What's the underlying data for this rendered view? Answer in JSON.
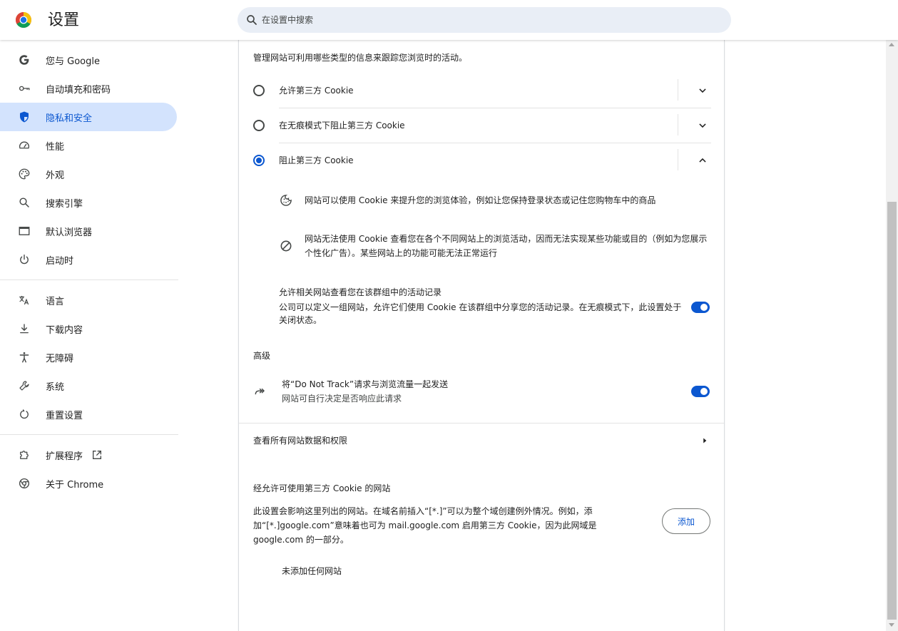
{
  "header": {
    "title": "设置",
    "search_placeholder": "在设置中搜索"
  },
  "sidebar": {
    "items": [
      {
        "label": "您与 Google",
        "icon": "google-g-icon"
      },
      {
        "label": "自动填充和密码",
        "icon": "key-icon"
      },
      {
        "label": "隐私和安全",
        "icon": "shield-icon",
        "active": true
      },
      {
        "label": "性能",
        "icon": "speedometer-icon"
      },
      {
        "label": "外观",
        "icon": "palette-icon"
      },
      {
        "label": "搜索引擎",
        "icon": "search-icon"
      },
      {
        "label": "默认浏览器",
        "icon": "browser-window-icon"
      },
      {
        "label": "启动时",
        "icon": "power-icon"
      },
      {
        "label": "语言",
        "icon": "translate-icon"
      },
      {
        "label": "下载内容",
        "icon": "download-icon"
      },
      {
        "label": "无障碍",
        "icon": "accessibility-icon"
      },
      {
        "label": "系统",
        "icon": "wrench-icon"
      },
      {
        "label": "重置设置",
        "icon": "reset-icon"
      },
      {
        "label": "扩展程序",
        "icon": "extension-puzzle-icon"
      },
      {
        "label": "关于 Chrome",
        "icon": "chrome-icon"
      }
    ]
  },
  "main": {
    "intro": "管理网站可利用哪些类型的信息来跟踪您浏览时的活动。",
    "options": [
      {
        "label": "允许第三方 Cookie",
        "selected": false,
        "expanded": false
      },
      {
        "label": "在无痕模式下阻止第三方 Cookie",
        "selected": false,
        "expanded": false
      },
      {
        "label": "阻止第三方 Cookie",
        "selected": true,
        "expanded": true
      }
    ],
    "details": [
      {
        "icon": "cookie-icon",
        "text": "网站可以使用 Cookie 来提升您的浏览体验，例如让您保持登录状态或记住您购物车中的商品"
      },
      {
        "icon": "block-icon",
        "text": "网站无法使用 Cookie 查看您在各个不同网站上的浏览活动，因而无法实现某些功能或目的（例如为您展示个性化广告）。某些网站上的功能可能无法正常运行"
      }
    ],
    "related_sites": {
      "title": "允许相关网站查看您在该群组中的活动记录",
      "subtitle": "公司可以定义一组网站，允许它们使用 Cookie 在该群组中分享您的活动记录。在无痕模式下，此设置处于关闭状态。",
      "enabled": true
    },
    "advanced_heading": "高级",
    "dnt": {
      "title": "将“Do Not Track”请求与浏览流量一起发送",
      "subtitle": "网站可自行决定是否响应此请求",
      "enabled": true
    },
    "site_data_link": "查看所有网站数据和权限",
    "allowed_sites": {
      "heading": "经允许可使用第三方 Cookie 的网站",
      "description": "此设置会影响这里列出的网站。在域名前插入“[*.]”可以为整个域创建例外情况。例如，添加“[*.]google.com”意味着也可为 mail.google.com 启用第三方 Cookie，因为此网域是 google.com 的一部分。",
      "add_button": "添加",
      "empty_text": "未添加任何网站"
    }
  },
  "colors": {
    "accent": "#0b57d0",
    "active_nav_bg": "#d3e3fd",
    "search_bg": "#e9eef6"
  }
}
